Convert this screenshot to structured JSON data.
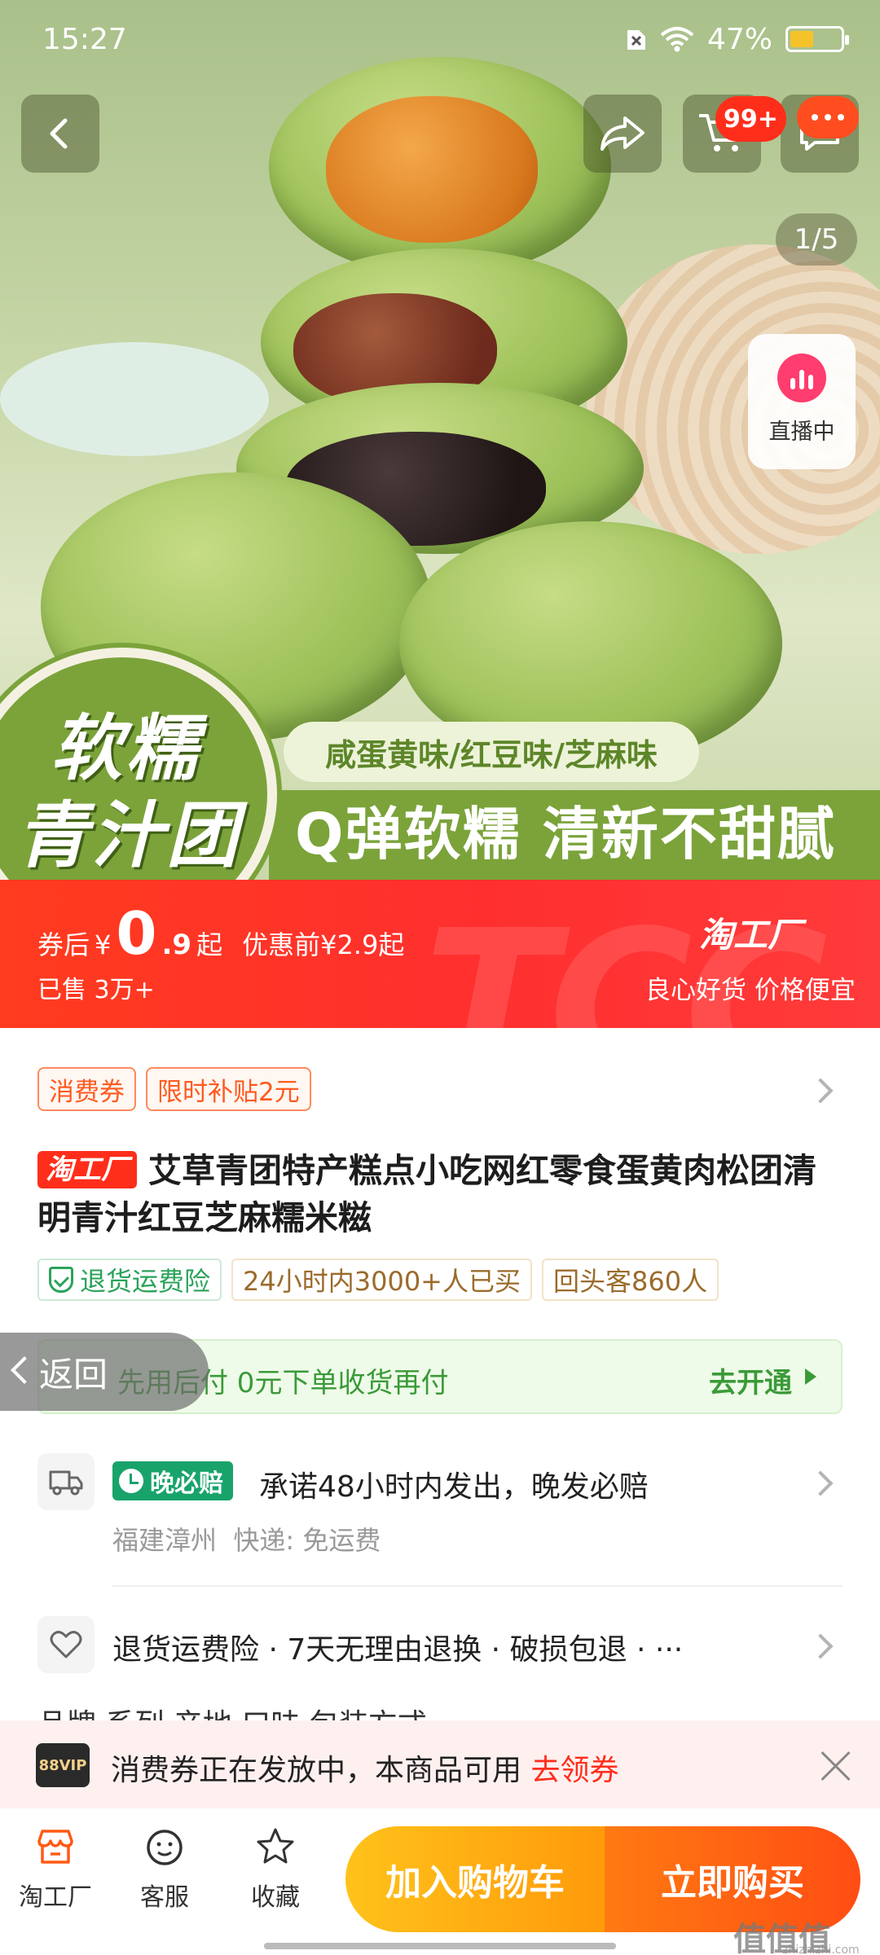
{
  "status_bar": {
    "time": "15:27",
    "battery_percent": "47%",
    "battery_level": 0.47
  },
  "gallery": {
    "counter": "1/5",
    "live_label": "直播中"
  },
  "header": {
    "cart_badge": "99+"
  },
  "hero_badge": {
    "line1": "软糯",
    "line2": "青汁团"
  },
  "hero_banner": {
    "flavors": "咸蛋黄味/红豆味/芝麻味",
    "slogan": "Q弹软糯 清新不甜腻"
  },
  "price": {
    "prefix": "券后",
    "currency": "¥",
    "int_part": "0",
    "dec_part": ".9",
    "suffix": "起",
    "original": "优惠前¥2.9起",
    "sold": "已售 3万+",
    "brand": "淘工厂",
    "brand_slogan": "良心好货 价格便宜"
  },
  "coupons": [
    "消费券",
    "限时补贴2元"
  ],
  "product": {
    "tag": "淘工厂",
    "title": "艾草青团特产糕点小吃网红零食蛋黄肉松团清明青汁红豆芝麻糯米糍"
  },
  "badges": {
    "return_insurance": "退货运费险",
    "bought_24h": "24小时内3000+人已买",
    "repeat": "回头客860人"
  },
  "pay_later": {
    "text": "先用后付  0元下单收货再付",
    "action": "去开通"
  },
  "back_button": "返回",
  "shipping": {
    "tag": "晚必赔",
    "promise": "承诺48小时内发出，晚发必赔",
    "origin": "福建漳州",
    "express": "快递: 免运费"
  },
  "services": "退货运费险 · 7天无理由退换 · 破损包退 · ···",
  "specs_peek": "品牌    系列    产地    口味    包装方式",
  "vip_banner": {
    "logo": "88VIP",
    "text": "消费券正在发放中，本商品可用 ",
    "link": "去领券"
  },
  "bottom_nav": [
    {
      "label": "淘工厂",
      "icon": "shop-icon"
    },
    {
      "label": "客服",
      "icon": "service-icon"
    },
    {
      "label": "收藏",
      "icon": "star-icon"
    }
  ],
  "cta": {
    "add_to_cart": "加入购物车",
    "buy_now": "立即购买"
  },
  "watermark": {
    "main": "值值值",
    "sub": "zhizhizhi.com"
  },
  "colors": {
    "accent": "#ff2e1b",
    "cta_orange": "#ff5a13",
    "cta_yellow": "#ffb31a",
    "green": "#7ba33a"
  }
}
